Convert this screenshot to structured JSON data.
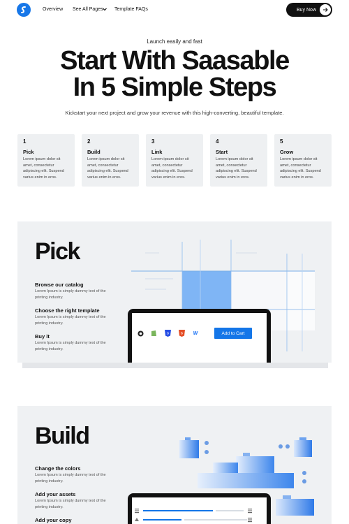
{
  "nav": {
    "links": [
      "Overview",
      "See All Pages",
      "Template FAQs"
    ],
    "buy_label": "Buy Now",
    "icons": [
      "logo-icon",
      "chevron-down-icon",
      "arrow-right-icon"
    ]
  },
  "hero": {
    "eyebrow": "Launch easily and fast",
    "title_line1": "Start With Saasable",
    "title_line2": "In 5 Simple Steps",
    "description": "Kickstart your next project and grow your revenue with this high-converting, beautiful template."
  },
  "steps": [
    {
      "num": "1",
      "name": "Pick",
      "text": "Lorem ipsum dolor sit amet, consectetur adipiscing elit. Suspend varius enim in eros."
    },
    {
      "num": "2",
      "name": "Build",
      "text": "Lorem ipsum dolor sit amet, consectetur adipiscing elit. Suspend varius enim in eros."
    },
    {
      "num": "3",
      "name": "Link",
      "text": "Lorem ipsum dolor sit amet, consectetur adipiscing elit. Suspend varius enim in eros."
    },
    {
      "num": "4",
      "name": "Start",
      "text": "Lorem ipsum dolor sit amet, consectetur adipiscing elit. Suspend varius enim in eros."
    },
    {
      "num": "5",
      "name": "Grow",
      "text": "Lorem ipsum dolor sit amet, consectetur adipiscing elit. Suspend varius enim in eros."
    }
  ],
  "pick": {
    "title": "Pick",
    "features": [
      {
        "heading": "Browse our catalog",
        "text": "Lorem Ipsum is simply dummy text of the printing industry."
      },
      {
        "heading": "Choose the right template",
        "text": "Lorem Ipsum is simply dummy text of the printing industry."
      },
      {
        "heading": "Buy it",
        "text": "Lorem Ipsum is simply dummy text of the printing industry."
      }
    ],
    "cart_label": "Add to Cart",
    "icons": [
      "github-icon",
      "shopify-icon",
      "css3-icon",
      "html5-icon",
      "webflow-icon"
    ],
    "accent": "#1476e8"
  },
  "build": {
    "title": "Build",
    "features": [
      {
        "heading": "Change the colors",
        "text": "Lorem Ipsum is simply dummy text of the printing industry."
      },
      {
        "heading": "Add your assets",
        "text": "Lorem Ipsum is simply dummy text of the printing industry."
      },
      {
        "heading": "Add your copy",
        "text": ""
      }
    ]
  }
}
